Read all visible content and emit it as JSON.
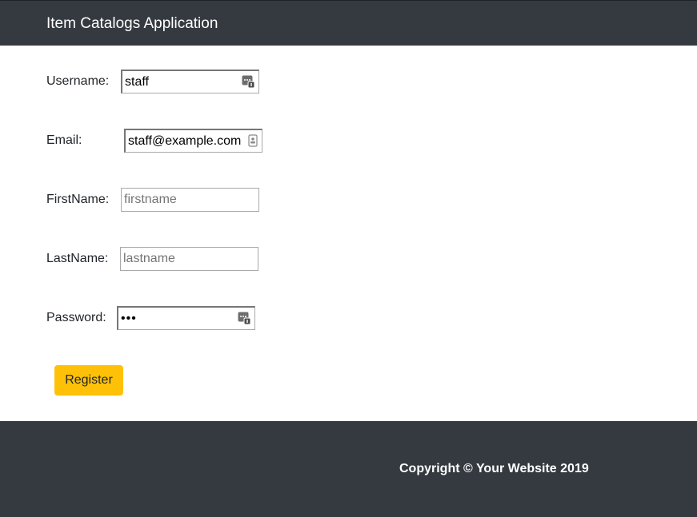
{
  "header": {
    "brand": "Item Catalogs Application"
  },
  "form": {
    "username": {
      "label": "Username:",
      "value": "staff",
      "placeholder": ""
    },
    "email": {
      "label": "Email:",
      "value": "staff@example.com",
      "placeholder": ""
    },
    "firstname": {
      "label": "FirstName:",
      "value": "",
      "placeholder": "firstname"
    },
    "lastname": {
      "label": "LastName:",
      "value": "",
      "placeholder": "lastname"
    },
    "password": {
      "label": "Password:",
      "value": "•••",
      "placeholder": ""
    },
    "submit_label": "Register"
  },
  "footer": {
    "copyright": "Copyright © Your Website 2019"
  },
  "icons": {
    "username_autofill": "password-manager-key-icon",
    "email_autofill": "contact-card-icon",
    "password_autofill": "password-manager-key-icon"
  },
  "colors": {
    "nav_background": "#343a40",
    "button_background": "#ffc107"
  }
}
